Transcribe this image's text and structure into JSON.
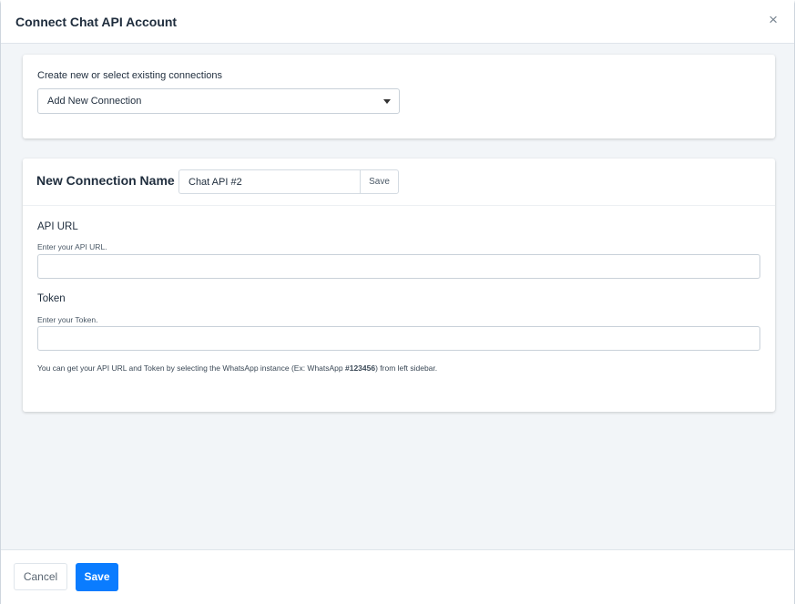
{
  "dialog": {
    "title": "Connect Chat API Account",
    "close_icon": "×"
  },
  "connection_select": {
    "label": "Create new or select existing connections",
    "selected": "Add New Connection"
  },
  "new_connection": {
    "title": "New Connection Name",
    "name_value": "Chat API #2",
    "save_label": "Save"
  },
  "fields": {
    "api_url": {
      "label": "API URL",
      "hint": "Enter your API URL.",
      "value": ""
    },
    "token": {
      "label": "Token",
      "hint": "Enter your Token.",
      "value": ""
    }
  },
  "footnote": {
    "before": "You can get your API URL and Token by selecting the WhatsApp instance (Ex: WhatsApp ",
    "bold": "#123456",
    "after": ") from left sidebar."
  },
  "footer": {
    "cancel_label": "Cancel",
    "save_label": "Save"
  },
  "colors": {
    "primary": "#0a7cff",
    "body_background": "#f2f5f8"
  }
}
